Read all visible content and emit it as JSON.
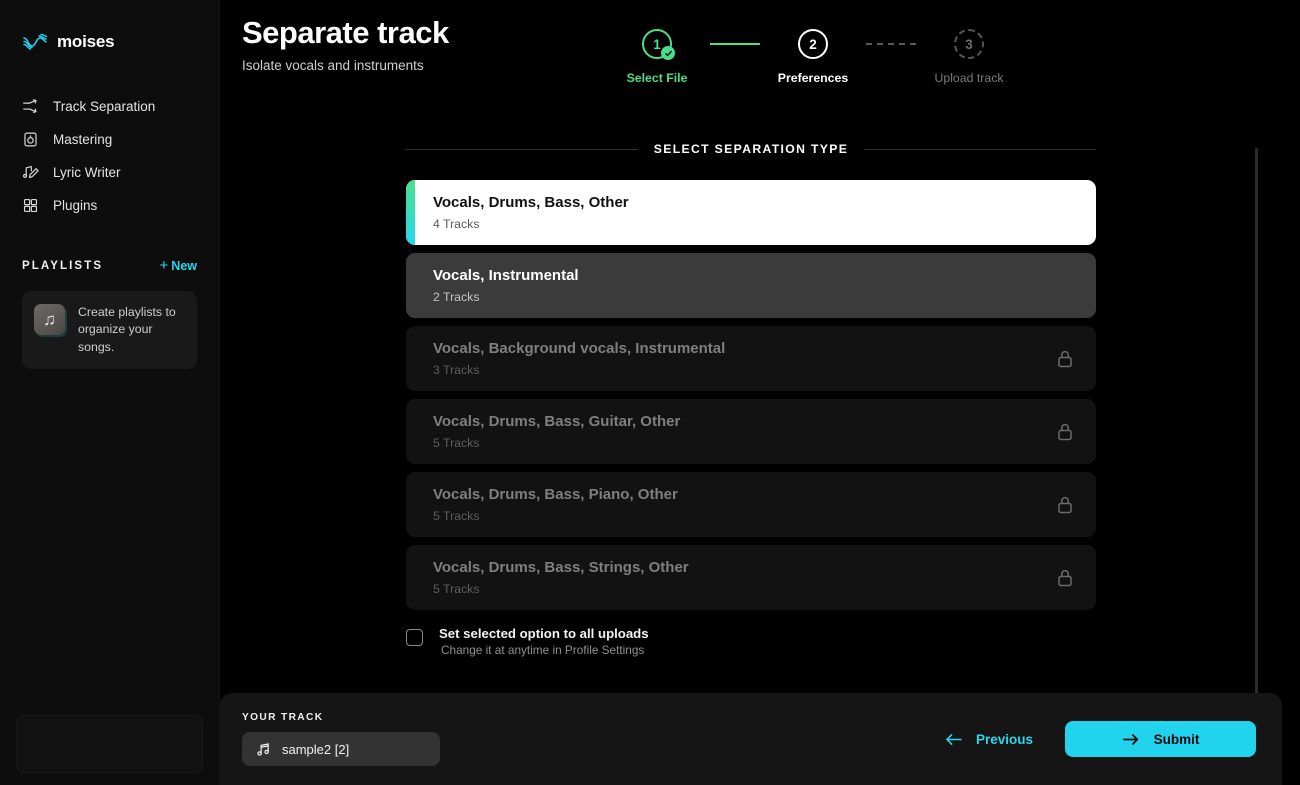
{
  "brand": {
    "name": "moises",
    "logo_icon": "wave-logo-icon",
    "accent": "#22d3ee"
  },
  "sidebar": {
    "items": [
      {
        "label": "Track Separation",
        "icon": "track-separation-icon"
      },
      {
        "label": "Mastering",
        "icon": "mastering-icon"
      },
      {
        "label": "Lyric Writer",
        "icon": "lyric-writer-icon"
      },
      {
        "label": "Plugins",
        "icon": "plugins-grid-icon"
      }
    ],
    "playlists": {
      "title": "PLAYLISTS",
      "new_label": "New",
      "new_plus": "+",
      "empty_card_text": "Create playlists to organize your songs.",
      "empty_card_icon": "music-note-icon"
    }
  },
  "header": {
    "title": "Separate track",
    "subtitle": "Isolate vocals and instruments"
  },
  "stepper": {
    "steps": [
      {
        "number": "1",
        "label": "Select File",
        "state": "done"
      },
      {
        "number": "2",
        "label": "Preferences",
        "state": "active"
      },
      {
        "number": "3",
        "label": "Upload track",
        "state": "todo"
      }
    ]
  },
  "section": {
    "title": "SELECT SEPARATION TYPE"
  },
  "options": [
    {
      "name": "Vocals, Drums, Bass, Other",
      "count": "4 Tracks",
      "state": "selected",
      "locked": false
    },
    {
      "name": "Vocals, Instrumental",
      "count": "2 Tracks",
      "state": "hover",
      "locked": false
    },
    {
      "name": "Vocals, Background vocals, Instrumental",
      "count": "3 Tracks",
      "state": "locked",
      "locked": true
    },
    {
      "name": "Vocals, Drums, Bass, Guitar, Other",
      "count": "5 Tracks",
      "state": "locked",
      "locked": true
    },
    {
      "name": "Vocals, Drums, Bass, Piano, Other",
      "count": "5 Tracks",
      "state": "locked",
      "locked": true
    },
    {
      "name": "Vocals, Drums, Bass, Strings, Other",
      "count": "5 Tracks",
      "state": "locked",
      "locked": true
    }
  ],
  "checkbox": {
    "checked": false,
    "label": "Set selected option to all uploads",
    "hint": "Change it at anytime in Profile Settings"
  },
  "footer": {
    "track_label": "YOUR TRACK",
    "track_name": "sample2 [2]",
    "track_icon": "music-note-icon",
    "previous_label": "Previous",
    "submit_label": "Submit"
  }
}
